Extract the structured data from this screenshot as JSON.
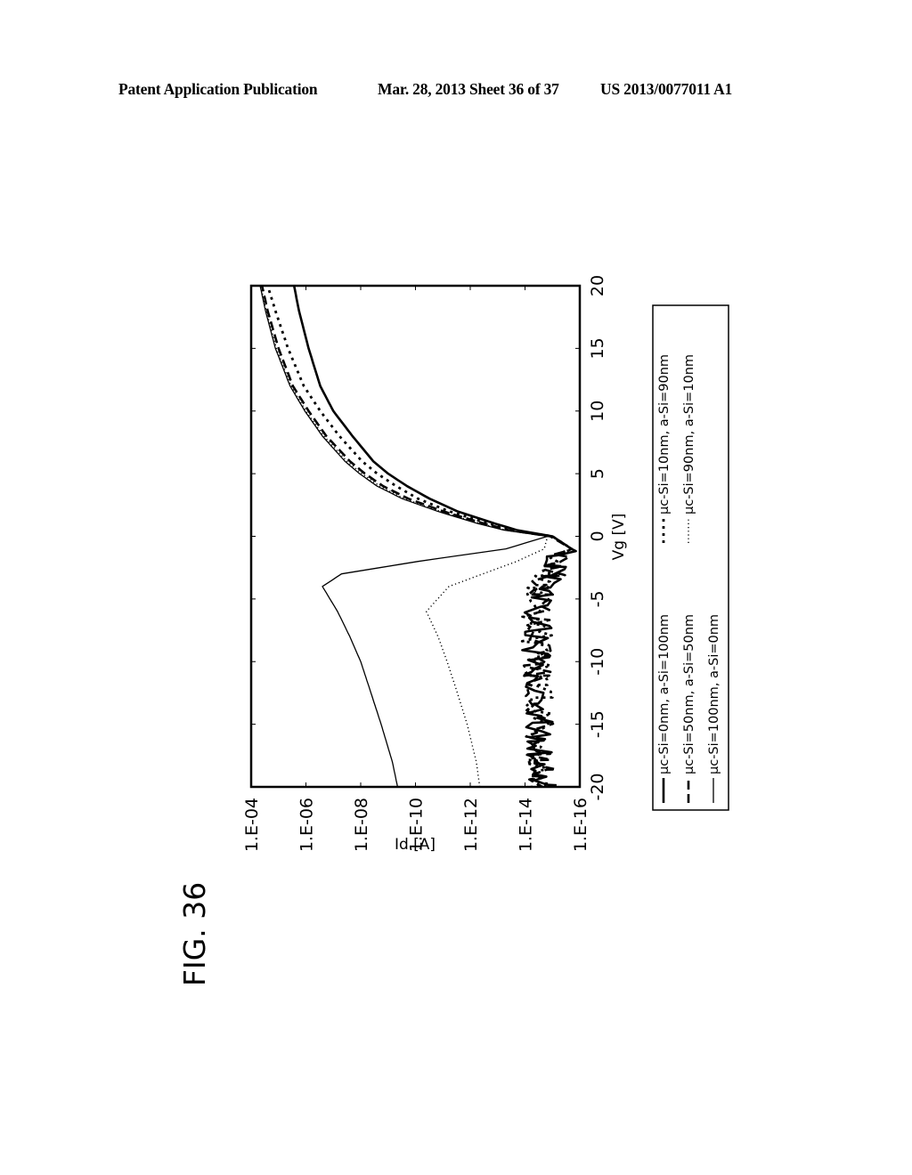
{
  "header": {
    "left": "Patent Application Publication",
    "middle": "Mar. 28, 2013  Sheet 36 of 37",
    "right": "US 2013/0077011 A1"
  },
  "figure": {
    "label": "FIG. 36",
    "orientation": "rotated 90 degrees counterclockwise"
  },
  "chart_data": {
    "type": "line",
    "title": "",
    "xlabel": "Vg [V]",
    "ylabel": "Id [A]",
    "xlim": [
      -20,
      20
    ],
    "ylim": [
      1e-16,
      0.0001
    ],
    "yscale": "log",
    "grid": false,
    "legend_position": "below",
    "x_ticks": [
      -20,
      -15,
      -10,
      -5,
      0,
      5,
      10,
      15,
      20
    ],
    "x_tick_labels": [
      "-20",
      "-15",
      "-10",
      "-5",
      "0",
      "5",
      "10",
      "15",
      "20"
    ],
    "y_ticks": [
      0.0001,
      1e-06,
      1e-08,
      1e-10,
      1e-12,
      1e-14,
      1e-16
    ],
    "y_tick_labels": [
      "1.E-04",
      "1.E-06",
      "1.E-08",
      "1.E-10",
      "1.E-12",
      "1.E-14",
      "1.E-16"
    ],
    "series": [
      {
        "name": "μc-Si=0nm, a-Si=100nm",
        "style": "solid-thick",
        "x": [
          -20,
          -15,
          -10,
          -5,
          -2,
          -1,
          0,
          0.5,
          1,
          2,
          3,
          4,
          5,
          6,
          8,
          10,
          12,
          15,
          18,
          20
        ],
        "y": [
          2.5e-15,
          3e-15,
          3.5e-15,
          4e-15,
          6e-16,
          2e-16,
          1e-15,
          2e-14,
          1.2e-13,
          3e-12,
          3e-11,
          2e-10,
          1e-09,
          3.5e-09,
          2e-08,
          1e-07,
          3e-07,
          8e-07,
          1.8e-06,
          2.7e-06
        ],
        "noisy_off_region": true
      },
      {
        "name": "μc-Si=10nm, a-Si=90nm",
        "style": "short-dash-thick",
        "x": [
          -20,
          -15,
          -10,
          -5,
          -2,
          -1,
          0,
          0.5,
          1,
          2,
          3,
          4,
          5,
          6,
          8,
          10,
          12,
          15,
          18,
          20
        ],
        "y": [
          2.5e-15,
          3e-15,
          3.5e-15,
          4e-15,
          6e-16,
          2e-16,
          1e-15,
          3e-14,
          2e-13,
          6e-12,
          8e-11,
          5e-10,
          2.5e-09,
          9e-09,
          6e-08,
          3e-07,
          1.2e-06,
          4.5e-06,
          1.3e-05,
          2.5e-05
        ],
        "noisy_off_region": true
      },
      {
        "name": "μc-Si=50nm, a-Si=50nm",
        "style": "long-dash-thick",
        "x": [
          -20,
          -15,
          -10,
          -5,
          -2,
          -1,
          0,
          0.5,
          1,
          2,
          3,
          4,
          5,
          6,
          8,
          10,
          12,
          15,
          18,
          20
        ],
        "y": [
          2.5e-15,
          3e-15,
          3.5e-15,
          4e-15,
          6e-16,
          2e-16,
          1.2e-15,
          4e-14,
          3e-13,
          1e-11,
          1.8e-10,
          1.5e-09,
          7e-09,
          2.5e-08,
          1.8e-07,
          8e-07,
          3e-06,
          1e-05,
          2.5e-05,
          4e-05
        ],
        "noisy_off_region": true
      },
      {
        "name": "μc-Si=90nm, a-Si=10nm",
        "style": "dotted-thin",
        "x": [
          -20,
          -18,
          -15,
          -12,
          -10,
          -8,
          -6,
          -4,
          -2,
          -1,
          0,
          0.5,
          1,
          2,
          3,
          4,
          5,
          6,
          8,
          10,
          12,
          15,
          18,
          20
        ],
        "y": [
          4.5e-13,
          6e-13,
          1.3e-12,
          3.5e-12,
          7e-12,
          1.5e-11,
          4e-11,
          6e-12,
          2e-14,
          2e-15,
          1.5e-15,
          5e-14,
          4e-13,
          1.3e-11,
          2.5e-10,
          2e-09,
          9e-09,
          3.2e-08,
          2.2e-07,
          1e-06,
          3.5e-06,
          1.2e-05,
          2.8e-05,
          4.5e-05
        ]
      },
      {
        "name": "μc-Si=100nm, a-Si=0nm",
        "style": "solid-thin",
        "x": [
          -20,
          -18,
          -15,
          -12,
          -10,
          -8,
          -6,
          -4,
          -3,
          -2,
          -1,
          0,
          0.5,
          1,
          2,
          3,
          4,
          5,
          6,
          8,
          10,
          12,
          15,
          18,
          20
        ],
        "y": [
          4.5e-10,
          7e-10,
          1.8e-09,
          5e-09,
          1e-08,
          2.5e-08,
          7e-08,
          2.5e-07,
          5e-08,
          8e-11,
          5e-14,
          1.5e-15,
          6e-14,
          5e-13,
          1.6e-11,
          3e-10,
          2.5e-09,
          1.1e-08,
          3.8e-08,
          2.5e-07,
          1.1e-06,
          3.8e-06,
          1.3e-05,
          3e-05,
          4.7e-05
        ]
      }
    ]
  }
}
